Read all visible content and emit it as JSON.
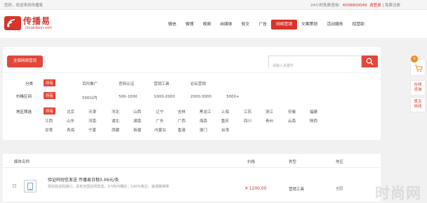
{
  "topbar": {
    "welcome": "您好，欢迎来到传播易",
    "hotline_label": "24小时免费咨询：",
    "hotline_number": "4008800049",
    "login": "请登录",
    "register": "免费注册",
    "sep": "|"
  },
  "logo": {
    "name_cn": "传播易",
    "name_en": "chuanboyi.com"
  },
  "nav": {
    "items": [
      "微信",
      "微博",
      "视频",
      "自媒体",
      "软文",
      "广告",
      "网络营销",
      "文案策划",
      "活动服务",
      "招营助"
    ],
    "active_index": 6
  },
  "filters": {
    "all_button": "全部网络营销",
    "search_placeholder": "请输入关键字",
    "category": {
      "label": "分类",
      "options": [
        "所有",
        "百科推广",
        "官网认证",
        "营销工具",
        "论坛营销"
      ]
    },
    "price": {
      "label": "价格区间",
      "options": [
        "所有",
        "500以内",
        "500-1000",
        "1000-2000",
        "2000-3000",
        "3000+"
      ]
    },
    "region": {
      "label": "地区筛选",
      "row1": [
        "所有",
        "北京",
        "天津",
        "河北",
        "山西",
        "辽宁",
        "吉林",
        "黑龙江",
        "上海",
        "江苏",
        "浙江",
        "安徽",
        "福建"
      ],
      "row2": [
        "江西",
        "山东",
        "河南",
        "湖北",
        "湖南",
        "广东",
        "广西",
        "海南",
        "重庆",
        "四川",
        "贵州",
        "云南",
        "陕西"
      ],
      "row3": [
        "甘肃",
        "青海",
        "宁夏",
        "西藏",
        "新疆",
        "内蒙古",
        "香港",
        "澳门",
        "台湾"
      ]
    }
  },
  "table": {
    "headers": [
      "媒体名称",
      "价格",
      "类型",
      "地区"
    ],
    "rows": [
      {
        "title": "验证码短信发送 传播易日租0.06元/条",
        "desc": "短信验证码接口，具有全国全网发送，3-5秒内确定，100%到达，速通路保障",
        "price": "¥ 1200.00",
        "type": "营销工具",
        "region": "全国"
      }
    ]
  },
  "side": {
    "cart_count": "0",
    "online_consult": [
      "在线",
      "咨询"
    ],
    "hot_feedback": [
      "意见",
      "热线"
    ]
  },
  "watermark": "时尚网"
}
